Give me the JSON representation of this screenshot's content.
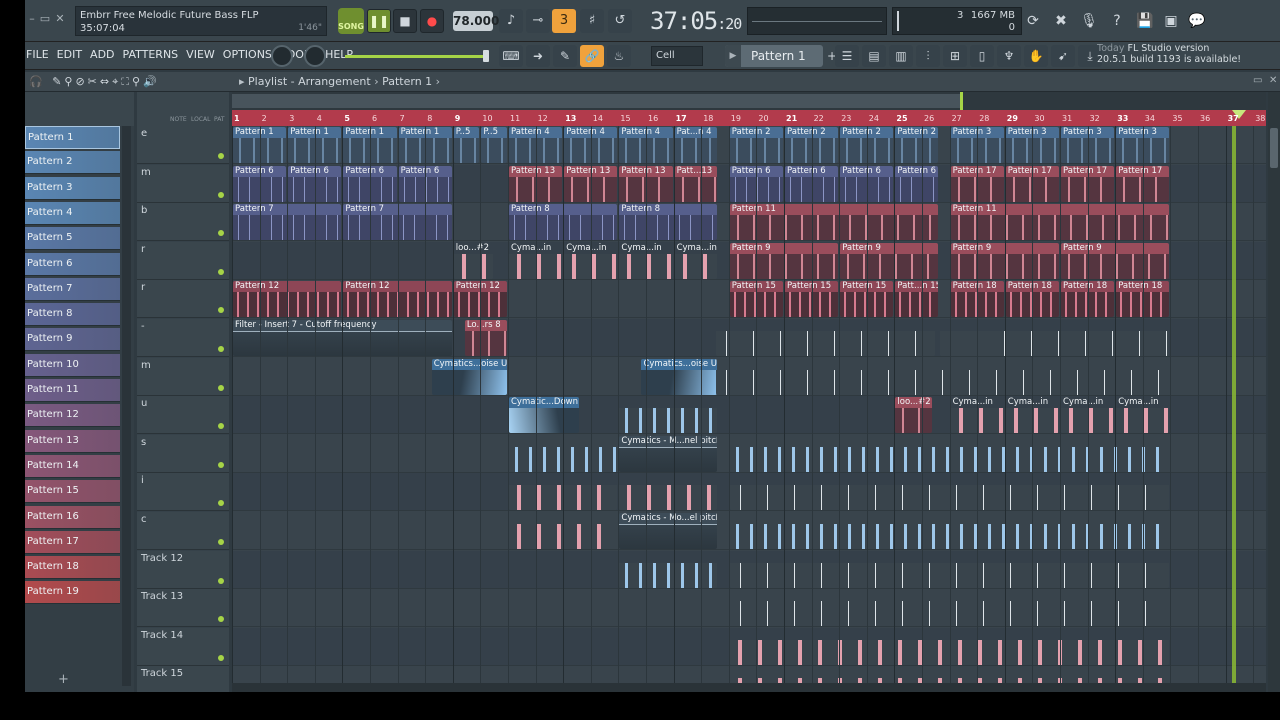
{
  "app": {
    "project_title": "Embrr Free Melodic Future Bass FLP",
    "project_time": "35:07:04",
    "project_len": "1'46\""
  },
  "transport": {
    "mode": "SONG",
    "tempo": "78.000",
    "time_main": "37:05",
    "time_sub": ":20"
  },
  "monitor": {
    "cpu_voices": "3",
    "memory": "1667 MB",
    "poly": "0"
  },
  "menu": [
    "FILE",
    "EDIT",
    "ADD",
    "PATTERNS",
    "VIEW",
    "OPTIONS",
    "TOOLS",
    "HELP"
  ],
  "snap": "Cell",
  "current_pattern": "Pattern 1",
  "news": {
    "line1": "Today",
    "line1b": "FL Studio version",
    "line2": "20.5.1 build 1193 is available!"
  },
  "playlist": {
    "title": "Playlist - Arrangement",
    "pattern": "Pattern 1",
    "header_labels": [
      "NOTE",
      "LOCAL",
      "PAT"
    ]
  },
  "patterns": [
    {
      "label": "Pattern 1",
      "color": "#5a86b3"
    },
    {
      "label": "Pattern 2",
      "color": "#5a86b3"
    },
    {
      "label": "Pattern 3",
      "color": "#5a86b3"
    },
    {
      "label": "Pattern 4",
      "color": "#5a86b3"
    },
    {
      "label": "Pattern 5",
      "color": "#5a78a6"
    },
    {
      "label": "Pattern 6",
      "color": "#5a78a6"
    },
    {
      "label": "Pattern 7",
      "color": "#5b6e9c"
    },
    {
      "label": "Pattern 8",
      "color": "#5b6695"
    },
    {
      "label": "Pattern 9",
      "color": "#5f6592"
    },
    {
      "label": "Pattern 10",
      "color": "#66618e"
    },
    {
      "label": "Pattern 11",
      "color": "#6e5e8a"
    },
    {
      "label": "Pattern 12",
      "color": "#7b5a82"
    },
    {
      "label": "Pattern 13",
      "color": "#85577a"
    },
    {
      "label": "Pattern 14",
      "color": "#8d5573"
    },
    {
      "label": "Pattern 15",
      "color": "#94536b"
    },
    {
      "label": "Pattern 16",
      "color": "#9b5163"
    },
    {
      "label": "Pattern 17",
      "color": "#a24d5a"
    },
    {
      "label": "Pattern 18",
      "color": "#aa4b52"
    },
    {
      "label": "Pattern 19",
      "color": "#b24a4c"
    }
  ],
  "tracks": [
    "e",
    "m",
    "b",
    "r",
    "r",
    "-",
    "m",
    "u",
    "s",
    "i",
    "c",
    "Track 12",
    "Track 13",
    "Track 14",
    "Track 15"
  ],
  "ruler": [
    "1",
    "2",
    "3",
    "4",
    "5",
    "6",
    "7",
    "8",
    "9",
    "10",
    "11",
    "12",
    "13",
    "14",
    "15",
    "16",
    "17",
    "18",
    "19",
    "20",
    "21",
    "22",
    "23",
    "24",
    "25",
    "26",
    "27",
    "28",
    "29",
    "30",
    "31",
    "32",
    "33",
    "34",
    "35",
    "36",
    "37",
    "38"
  ],
  "clips": [
    {
      "track": 0,
      "bar": 1,
      "len": 2,
      "style": "c-blue",
      "label": "Pattern 1"
    },
    {
      "track": 0,
      "bar": 3,
      "len": 2,
      "style": "c-blue",
      "label": "Pattern 1"
    },
    {
      "track": 0,
      "bar": 5,
      "len": 2,
      "style": "c-blue",
      "label": "Pattern 1"
    },
    {
      "track": 0,
      "bar": 7,
      "len": 2,
      "style": "c-blue",
      "label": "Pattern 1"
    },
    {
      "track": 0,
      "bar": 9,
      "len": 1,
      "style": "c-blue",
      "label": "P..5"
    },
    {
      "track": 0,
      "bar": 10,
      "len": 1,
      "style": "c-blue",
      "label": "P..5"
    },
    {
      "track": 0,
      "bar": 11,
      "len": 2,
      "style": "c-blue",
      "label": "Pattern 4"
    },
    {
      "track": 0,
      "bar": 13,
      "len": 2,
      "style": "c-blue",
      "label": "Pattern 4"
    },
    {
      "track": 0,
      "bar": 15,
      "len": 2,
      "style": "c-blue",
      "label": "Pattern 4"
    },
    {
      "track": 0,
      "bar": 17,
      "len": 1.6,
      "style": "c-blue",
      "label": "Pat...n 4"
    },
    {
      "track": 0,
      "bar": 19,
      "len": 2,
      "style": "c-blue",
      "label": "Pattern 2"
    },
    {
      "track": 0,
      "bar": 21,
      "len": 2,
      "style": "c-blue",
      "label": "Pattern 2"
    },
    {
      "track": 0,
      "bar": 23,
      "len": 2,
      "style": "c-blue",
      "label": "Pattern 2"
    },
    {
      "track": 0,
      "bar": 25,
      "len": 1.6,
      "style": "c-blue",
      "label": "Pattern 2"
    },
    {
      "track": 0,
      "bar": 27,
      "len": 2,
      "style": "c-blue",
      "label": "Pattern 3"
    },
    {
      "track": 0,
      "bar": 29,
      "len": 2,
      "style": "c-blue",
      "label": "Pattern 3"
    },
    {
      "track": 0,
      "bar": 31,
      "len": 2,
      "style": "c-blue",
      "label": "Pattern 3"
    },
    {
      "track": 0,
      "bar": 33,
      "len": 2,
      "style": "c-blue",
      "label": "Pattern 3"
    },
    {
      "track": 1,
      "bar": 1,
      "len": 2,
      "style": "c-slate",
      "label": "Pattern 6"
    },
    {
      "track": 1,
      "bar": 3,
      "len": 2,
      "style": "c-slate",
      "label": "Pattern 6"
    },
    {
      "track": 1,
      "bar": 5,
      "len": 2,
      "style": "c-slate",
      "label": "Pattern 6"
    },
    {
      "track": 1,
      "bar": 7,
      "len": 2,
      "style": "c-slate",
      "label": "Pattern 6"
    },
    {
      "track": 1,
      "bar": 11,
      "len": 2,
      "style": "c-pink",
      "label": "Pattern 13"
    },
    {
      "track": 1,
      "bar": 13,
      "len": 2,
      "style": "c-pink",
      "label": "Pattern 13"
    },
    {
      "track": 1,
      "bar": 15,
      "len": 2,
      "style": "c-pink",
      "label": "Pattern 13"
    },
    {
      "track": 1,
      "bar": 17,
      "len": 1.6,
      "style": "c-pink",
      "label": "Patt...13"
    },
    {
      "track": 1,
      "bar": 19,
      "len": 2,
      "style": "c-slate",
      "label": "Pattern 6"
    },
    {
      "track": 1,
      "bar": 21,
      "len": 2,
      "style": "c-slate",
      "label": "Pattern 6"
    },
    {
      "track": 1,
      "bar": 23,
      "len": 2,
      "style": "c-slate",
      "label": "Pattern 6"
    },
    {
      "track": 1,
      "bar": 25,
      "len": 1.6,
      "style": "c-slate",
      "label": "Pattern 6"
    },
    {
      "track": 1,
      "bar": 27,
      "len": 2,
      "style": "c-pink",
      "label": "Pattern 17"
    },
    {
      "track": 1,
      "bar": 29,
      "len": 2,
      "style": "c-pink",
      "label": "Pattern 17"
    },
    {
      "track": 1,
      "bar": 31,
      "len": 2,
      "style": "c-pink",
      "label": "Pattern 17"
    },
    {
      "track": 1,
      "bar": 33,
      "len": 2,
      "style": "c-pink",
      "label": "Pattern 17"
    },
    {
      "track": 2,
      "bar": 1,
      "len": 4,
      "style": "c-slate",
      "label": "Pattern 7"
    },
    {
      "track": 2,
      "bar": 5,
      "len": 4,
      "style": "c-slate",
      "label": "Pattern 7"
    },
    {
      "track": 2,
      "bar": 11,
      "len": 4,
      "style": "c-slate",
      "label": "Pattern 8"
    },
    {
      "track": 2,
      "bar": 15,
      "len": 3.6,
      "style": "c-slate",
      "label": "Pattern 8"
    },
    {
      "track": 2,
      "bar": 19,
      "len": 7.6,
      "style": "c-pink",
      "label": "Pattern 11"
    },
    {
      "track": 2,
      "bar": 27,
      "len": 8,
      "style": "c-pink",
      "label": "Pattern 11"
    },
    {
      "track": 3,
      "bar": 9,
      "len": 1.5,
      "style": "c-wave-p",
      "label": "loo...#2"
    },
    {
      "track": 3,
      "bar": 11,
      "len": 2,
      "style": "c-wave-p",
      "label": "Cyma...in"
    },
    {
      "track": 3,
      "bar": 13,
      "len": 2,
      "style": "c-wave-p",
      "label": "Cyma...in"
    },
    {
      "track": 3,
      "bar": 15,
      "len": 2,
      "style": "c-wave-p",
      "label": "Cyma...in"
    },
    {
      "track": 3,
      "bar": 17,
      "len": 1.6,
      "style": "c-wave-p",
      "label": "Cyma...in"
    },
    {
      "track": 3,
      "bar": 19,
      "len": 4,
      "style": "c-pink",
      "label": "Pattern 9"
    },
    {
      "track": 3,
      "bar": 23,
      "len": 3.6,
      "style": "c-pink",
      "label": "Pattern 9"
    },
    {
      "track": 3,
      "bar": 27,
      "len": 4,
      "style": "c-pink",
      "label": "Pattern 9"
    },
    {
      "track": 3,
      "bar": 31,
      "len": 4,
      "style": "c-pink",
      "label": "Pattern 9"
    },
    {
      "track": 4,
      "bar": 1,
      "len": 4,
      "style": "c-rose",
      "label": "Pattern 12"
    },
    {
      "track": 4,
      "bar": 5,
      "len": 4,
      "style": "c-rose",
      "label": "Pattern 12"
    },
    {
      "track": 4,
      "bar": 9,
      "len": 2,
      "style": "c-rose",
      "label": "Pattern 12"
    },
    {
      "track": 4,
      "bar": 19,
      "len": 2,
      "style": "c-rose",
      "label": "Pattern 15"
    },
    {
      "track": 4,
      "bar": 21,
      "len": 2,
      "style": "c-rose",
      "label": "Pattern 15"
    },
    {
      "track": 4,
      "bar": 23,
      "len": 2,
      "style": "c-rose",
      "label": "Pattern 15"
    },
    {
      "track": 4,
      "bar": 25,
      "len": 1.6,
      "style": "c-rose",
      "label": "Patt...n 15"
    },
    {
      "track": 4,
      "bar": 27,
      "len": 2,
      "style": "c-rose",
      "label": "Pattern 18"
    },
    {
      "track": 4,
      "bar": 29,
      "len": 2,
      "style": "c-rose",
      "label": "Pattern 18"
    },
    {
      "track": 4,
      "bar": 31,
      "len": 2,
      "style": "c-rose",
      "label": "Pattern 18"
    },
    {
      "track": 4,
      "bar": 33,
      "len": 2,
      "style": "c-rose",
      "label": "Pattern 18"
    },
    {
      "track": 5,
      "bar": 1,
      "len": 8,
      "style": "c-auto",
      "label": "Filter - Insert 7 - Cutoff frequency"
    },
    {
      "track": 5,
      "bar": 9.4,
      "len": 1.6,
      "style": "c-pink",
      "label": "Lo...rs 8"
    },
    {
      "track": 5,
      "bar": 18.5,
      "len": 8,
      "style": "c-tick",
      "label": ""
    },
    {
      "track": 5,
      "bar": 26.6,
      "len": 8.4,
      "style": "c-tick",
      "label": ""
    },
    {
      "track": 6,
      "bar": 8.2,
      "len": 2.8,
      "style": "c-cyan",
      "label": "Cymatics...oise Up"
    },
    {
      "track": 6,
      "bar": 15.8,
      "len": 2.8,
      "style": "c-cyan",
      "label": "Cymatics...oise Up"
    },
    {
      "track": 6,
      "bar": 18.5,
      "len": 16.5,
      "style": "c-tick",
      "label": ""
    },
    {
      "track": 7,
      "bar": 11,
      "len": 2.6,
      "style": "c-down",
      "label": "Cymatic...Down"
    },
    {
      "track": 7,
      "bar": 15,
      "len": 3.6,
      "style": "c-wave",
      "label": ""
    },
    {
      "track": 7,
      "bar": 25,
      "len": 1.4,
      "style": "c-pink",
      "label": "loo...#2"
    },
    {
      "track": 7,
      "bar": 27,
      "len": 2,
      "style": "c-wave-p",
      "label": "Cyma...in"
    },
    {
      "track": 7,
      "bar": 29,
      "len": 2,
      "style": "c-wave-p",
      "label": "Cyma...in"
    },
    {
      "track": 7,
      "bar": 31,
      "len": 2,
      "style": "c-wave-p",
      "label": "Cyma...in"
    },
    {
      "track": 7,
      "bar": 33,
      "len": 2,
      "style": "c-wave-p",
      "label": "Cyma...in"
    },
    {
      "track": 8,
      "bar": 11,
      "len": 4,
      "style": "c-wave",
      "label": ""
    },
    {
      "track": 8,
      "bar": 15,
      "len": 3.6,
      "style": "c-auto",
      "label": "Cymatics - M...nel pitch"
    },
    {
      "track": 8,
      "bar": 19,
      "len": 16,
      "style": "c-wave",
      "label": ""
    },
    {
      "track": 9,
      "bar": 11,
      "len": 4,
      "style": "c-wave-p",
      "label": ""
    },
    {
      "track": 9,
      "bar": 15,
      "len": 3.6,
      "style": "c-wave-p",
      "label": ""
    },
    {
      "track": 9,
      "bar": 19,
      "len": 16,
      "style": "c-tick",
      "label": ""
    },
    {
      "track": 10,
      "bar": 11,
      "len": 4,
      "style": "c-wave-p",
      "label": ""
    },
    {
      "track": 10,
      "bar": 15,
      "len": 3.6,
      "style": "c-auto",
      "label": "Cymatics - Mo...el pitch"
    },
    {
      "track": 10,
      "bar": 19,
      "len": 16,
      "style": "c-wave",
      "label": ""
    },
    {
      "track": 11,
      "bar": 15,
      "len": 3.6,
      "style": "c-wave",
      "label": ""
    },
    {
      "track": 11,
      "bar": 19,
      "len": 16,
      "style": "c-tick",
      "label": ""
    },
    {
      "track": 12,
      "bar": 19,
      "len": 16,
      "style": "c-tick",
      "label": ""
    },
    {
      "track": 13,
      "bar": 19,
      "len": 16,
      "style": "c-wave-p",
      "label": ""
    },
    {
      "track": 14,
      "bar": 19,
      "len": 16,
      "style": "c-wave-p",
      "label": ""
    }
  ]
}
